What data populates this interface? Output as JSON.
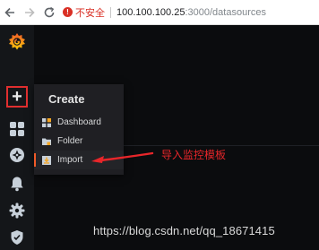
{
  "browser": {
    "back_icon": "back-arrow-icon",
    "forward_icon": "forward-arrow-icon",
    "reload_icon": "reload-icon",
    "security_warning": "不安全",
    "url_host": "100.100.100.25",
    "url_path": ":3000/datasources"
  },
  "sidebar": {
    "logo": "grafana-logo",
    "items": [
      {
        "name": "create",
        "icon": "plus-icon",
        "highlight_color": "#e02f2f"
      },
      {
        "name": "dashboards",
        "icon": "grid-icon"
      },
      {
        "name": "explore",
        "icon": "compass-icon"
      },
      {
        "name": "alerting",
        "icon": "bell-icon"
      },
      {
        "name": "configuration",
        "icon": "gear-icon"
      },
      {
        "name": "admin",
        "icon": "shield-icon"
      }
    ]
  },
  "create_menu": {
    "title": "Create",
    "items": [
      {
        "label": "Dashboard",
        "icon": "dashboard-icon"
      },
      {
        "label": "Folder",
        "icon": "folder-icon"
      },
      {
        "label": "Import",
        "icon": "import-icon",
        "active": true
      }
    ]
  },
  "annotation": {
    "text": "导入监控模板",
    "color": "#e8262a"
  },
  "watermark": "https://blog.csdn.net/qq_18671415"
}
